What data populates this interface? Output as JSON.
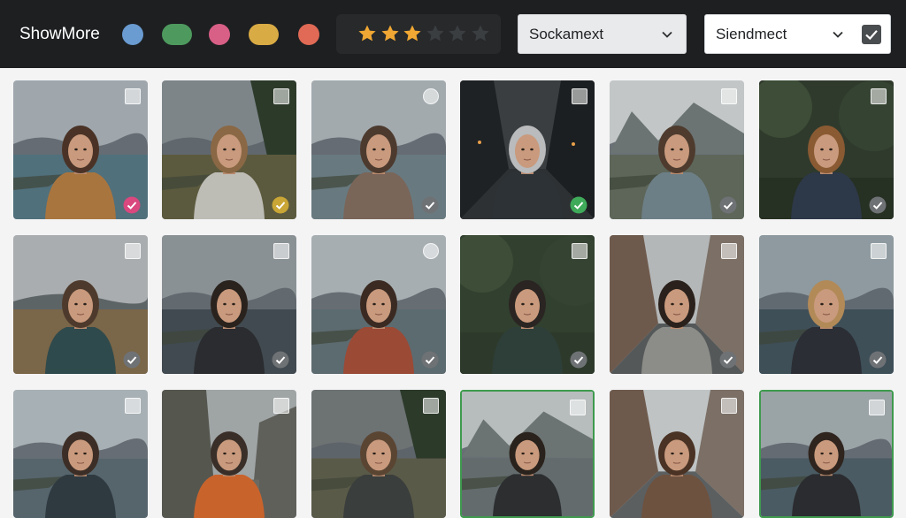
{
  "toolbar": {
    "brand": "ShowMore",
    "color_filters": [
      {
        "name": "blue",
        "color": "#6a9bd1"
      },
      {
        "name": "green",
        "color": "#4e9a5e"
      },
      {
        "name": "pink",
        "color": "#d85f86"
      },
      {
        "name": "yellow",
        "color": "#d9ab45"
      },
      {
        "name": "orange",
        "color": "#e06a55"
      }
    ],
    "rating": {
      "value": 3,
      "max": 6,
      "filled_color": "#f0a733",
      "empty_color": "#3b3e41"
    },
    "sort_select": {
      "value": "Sockamext"
    },
    "select_two": {
      "value": "Siendmect",
      "checked": true
    }
  },
  "gallery": {
    "photos": [
      {
        "name": "photo-1",
        "scene": "lake",
        "sky": "#9fa7ad",
        "ground": "#50707c",
        "coat": "#a9753e",
        "hair": "#4a3326",
        "check": "pink"
      },
      {
        "name": "photo-2",
        "scene": "forest-lake",
        "sky": "#7d8589",
        "ground": "#5c5a3e",
        "coat": "#bdbcb5",
        "hair": "#8a6845",
        "check": "yellow"
      },
      {
        "name": "photo-3",
        "scene": "lake",
        "sky": "#a2aaae",
        "ground": "#687a80",
        "coat": "#7a6559",
        "hair": "#4d3a2e",
        "check": "grey"
      },
      {
        "name": "photo-4",
        "scene": "street-night",
        "sky": "#3a3e40",
        "ground": "#2e3133",
        "coat": "#2c3236",
        "hair": "#b9bbbc",
        "check": "green"
      },
      {
        "name": "photo-5",
        "scene": "mountain-lake",
        "sky": "#c2c6c6",
        "ground": "#5d6659",
        "coat": "#6d7f86",
        "hair": "#4e3b2e",
        "check": "grey"
      },
      {
        "name": "photo-6",
        "scene": "forest",
        "sky": "#2f3a2c",
        "ground": "#263023",
        "coat": "#2d3848",
        "hair": "#8a5a33",
        "check": "grey"
      },
      {
        "name": "photo-7",
        "scene": "moor",
        "sky": "#a9adaf",
        "ground": "#7a6648",
        "coat": "#2f4a4c",
        "hair": "#4e3a2c",
        "check": "grey"
      },
      {
        "name": "photo-8",
        "scene": "lake",
        "sky": "#8a9194",
        "ground": "#414a50",
        "coat": "#2a2c2f",
        "hair": "#2a221d",
        "check": "grey"
      },
      {
        "name": "photo-9",
        "scene": "lake",
        "sky": "#a6aeb1",
        "ground": "#5c6b70",
        "coat": "#9b4a36",
        "hair": "#3a2a22",
        "check": "grey"
      },
      {
        "name": "photo-10",
        "scene": "forest",
        "sky": "#32402f",
        "ground": "#2d3a2b",
        "coat": "#2e3f3a",
        "hair": "#2a2522",
        "check": "grey"
      },
      {
        "name": "photo-11",
        "scene": "street",
        "sky": "#b4b7b8",
        "ground": "#545859",
        "coat": "#8c8d88",
        "hair": "#2a211c",
        "check": "grey"
      },
      {
        "name": "photo-12",
        "scene": "lake",
        "sky": "#8e9a9f",
        "ground": "#3e4f58",
        "coat": "#2b2e34",
        "hair": "#b28a58",
        "check": "grey"
      },
      {
        "name": "photo-13",
        "scene": "lake",
        "sky": "#a7b0b4",
        "ground": "#56656c",
        "coat": "#2f3a40",
        "hair": "#3c2e26",
        "check": "none"
      },
      {
        "name": "photo-14",
        "scene": "cliffs",
        "sky": "#9fa4a5",
        "ground": "#6a6a62",
        "coat": "#c9632c",
        "hair": "#3a2f28",
        "check": "none"
      },
      {
        "name": "photo-15",
        "scene": "forest-lake",
        "sky": "#6d7273",
        "ground": "#5a5a48",
        "coat": "#3a3e3c",
        "hair": "#5a4533",
        "check": "none"
      },
      {
        "name": "photo-16",
        "scene": "mountain-lake",
        "sky": "#b7bcbc",
        "ground": "#636b6d",
        "coat": "#2c2e30",
        "hair": "#2a221c",
        "check": "none",
        "highlight": true
      },
      {
        "name": "photo-17",
        "scene": "street",
        "sky": "#bfc3c4",
        "ground": "#5b5f60",
        "coat": "#6e5240",
        "hair": "#4a3224",
        "check": "none"
      },
      {
        "name": "photo-18",
        "scene": "lake",
        "sky": "#9aa3a6",
        "ground": "#4a5b63",
        "coat": "#2b2c2f",
        "hair": "#2f241e",
        "check": "none",
        "highlight": true
      }
    ],
    "check_colors": {
      "pink": "#d9487e",
      "yellow": "#c9a635",
      "green": "#3faa5a",
      "grey": "#6f7275"
    }
  }
}
